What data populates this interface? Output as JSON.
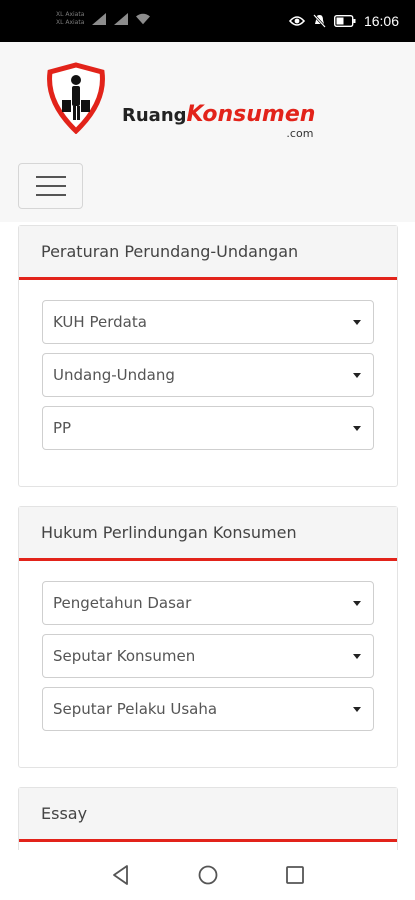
{
  "status_bar": {
    "carrier_line1": "XL Axiata",
    "carrier_line2": "XL Axiata",
    "time": "16:06",
    "icons": [
      "signal-icon",
      "signal-icon",
      "wifi-icon",
      "eye-icon",
      "mute-icon",
      "battery-icon"
    ]
  },
  "header": {
    "brand_ruang": "Ruang",
    "brand_konsumen": "Konsumen",
    "brand_suffix": ".com",
    "menu_icon": "hamburger-icon"
  },
  "sections": [
    {
      "title": "Peraturan Perundang-Undangan",
      "dropdowns": [
        "KUH Perdata",
        "Undang-Undang",
        "PP"
      ]
    },
    {
      "title": "Hukum Perlindungan Konsumen",
      "dropdowns": [
        "Pengetahun Dasar",
        "Seputar Konsumen",
        "Seputar Pelaku Usaha"
      ]
    },
    {
      "title": "Essay",
      "dropdowns": []
    }
  ],
  "nav_bar": {
    "buttons": [
      "back-icon",
      "home-icon",
      "recents-icon"
    ]
  },
  "colors": {
    "accent": "#e2231a",
    "status_bar": "#000000",
    "header_bg": "#f7f7f7"
  }
}
